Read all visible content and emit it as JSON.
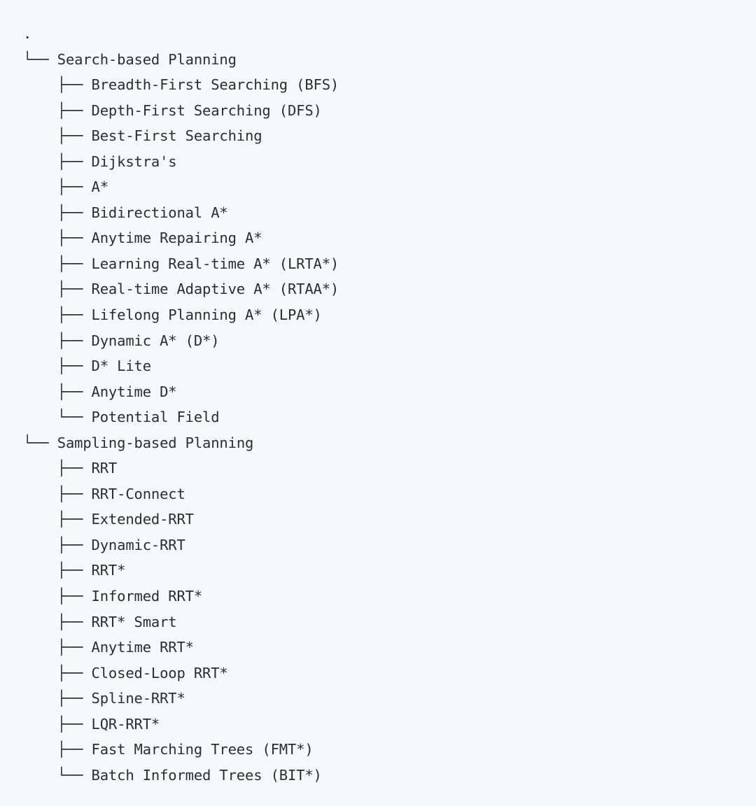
{
  "document": {
    "kind": "directory-tree-listing",
    "root_label": ".",
    "background_color": "#f7f8fa",
    "text_color": "#2c3034",
    "branch_mid": "├── ",
    "branch_last": "└── ",
    "branch_pipe": "│   ",
    "branch_blank": "    "
  },
  "tree": {
    "root": ".",
    "nodes": [
      {
        "label": "Search-based Planning",
        "last": true,
        "children": [
          "Breadth-First Searching (BFS)",
          "Depth-First Searching (DFS)",
          "Best-First Searching",
          "Dijkstra's",
          "A*",
          "Bidirectional A*",
          "Anytime Repairing A*",
          "Learning Real-time A* (LRTA*)",
          "Real-time Adaptive A* (RTAA*)",
          "Lifelong Planning A* (LPA*)",
          "Dynamic A* (D*)",
          "D* Lite",
          "Anytime D*",
          "Potential Field"
        ]
      },
      {
        "label": "Sampling-based Planning",
        "last": true,
        "children": [
          "RRT",
          "RRT-Connect",
          "Extended-RRT",
          "Dynamic-RRT",
          "RRT*",
          "Informed RRT*",
          "RRT* Smart",
          "Anytime RRT*",
          "Closed-Loop RRT*",
          "Spline-RRT*",
          "LQR-RRT*",
          "Fast Marching Trees (FMT*)",
          "Batch Informed Trees (BIT*)"
        ]
      }
    ]
  },
  "lines": [
    ".",
    "└── Search-based Planning",
    "    ├── Breadth-First Searching (BFS)",
    "    ├── Depth-First Searching (DFS)",
    "    ├── Best-First Searching",
    "    ├── Dijkstra's",
    "    ├── A*",
    "    ├── Bidirectional A*",
    "    ├── Anytime Repairing A*",
    "    ├── Learning Real-time A* (LRTA*)",
    "    ├── Real-time Adaptive A* (RTAA*)",
    "    ├── Lifelong Planning A* (LPA*)",
    "    ├── Dynamic A* (D*)",
    "    ├── D* Lite",
    "    ├── Anytime D*",
    "    └── Potential Field",
    "└── Sampling-based Planning",
    "    ├── RRT",
    "    ├── RRT-Connect",
    "    ├── Extended-RRT",
    "    ├── Dynamic-RRT",
    "    ├── RRT*",
    "    ├── Informed RRT*",
    "    ├── RRT* Smart",
    "    ├── Anytime RRT*",
    "    ├── Closed-Loop RRT*",
    "    ├── Spline-RRT*",
    "    ├── LQR-RRT*",
    "    ├── Fast Marching Trees (FMT*)",
    "    └── Batch Informed Trees (BIT*)"
  ]
}
